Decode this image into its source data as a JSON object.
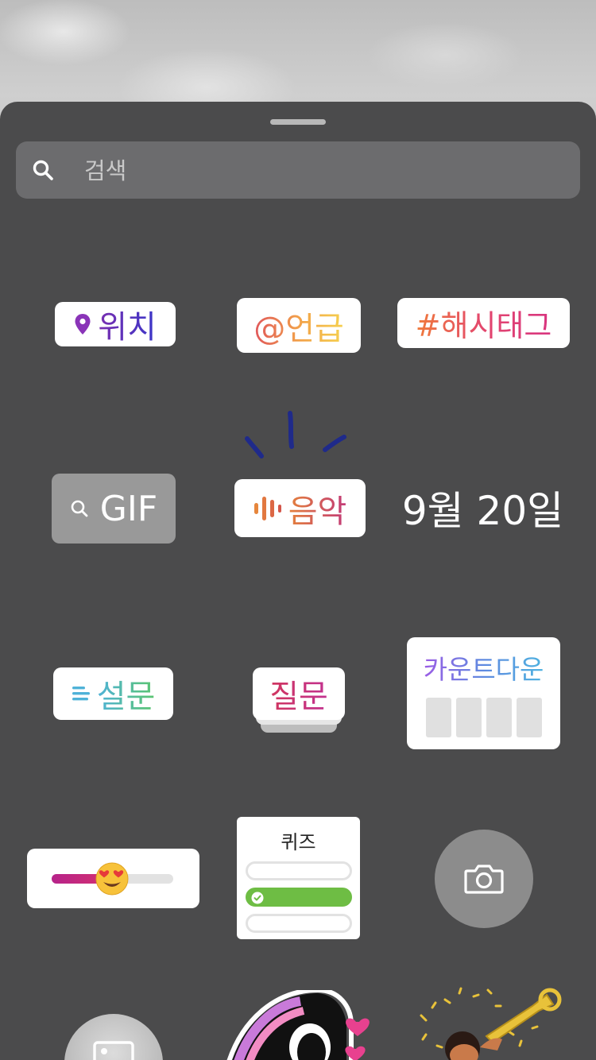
{
  "search": {
    "placeholder": "검색"
  },
  "stickers": {
    "location": {
      "label": "위치"
    },
    "mention": {
      "label": "@언급"
    },
    "hashtag": {
      "label": "#해시태그"
    },
    "gif": {
      "label": "GIF"
    },
    "music": {
      "label": "음악"
    },
    "date": {
      "label": "9월 20일"
    },
    "poll": {
      "label": "설문"
    },
    "question": {
      "label": "질문"
    },
    "countdown": {
      "label": "카운트다운"
    },
    "quiz": {
      "title": "퀴즈"
    }
  },
  "icons": {
    "search": "search-icon",
    "location": "location-pin-icon",
    "gif_search": "search-icon",
    "music": "audio-bars-icon",
    "poll": "poll-lines-icon",
    "slider_emoji": "heart-eyes-emoji-icon",
    "quiz_check": "check-icon",
    "camera": "camera-icon",
    "gallery": "image-icon"
  },
  "colors": {
    "sheet_bg": "#4b4b4c",
    "search_bg": "#6c6c6e",
    "camera_bg": "#8c8c8c",
    "quiz_correct": "#6ebd44"
  },
  "slider": {
    "value": 0.5
  }
}
